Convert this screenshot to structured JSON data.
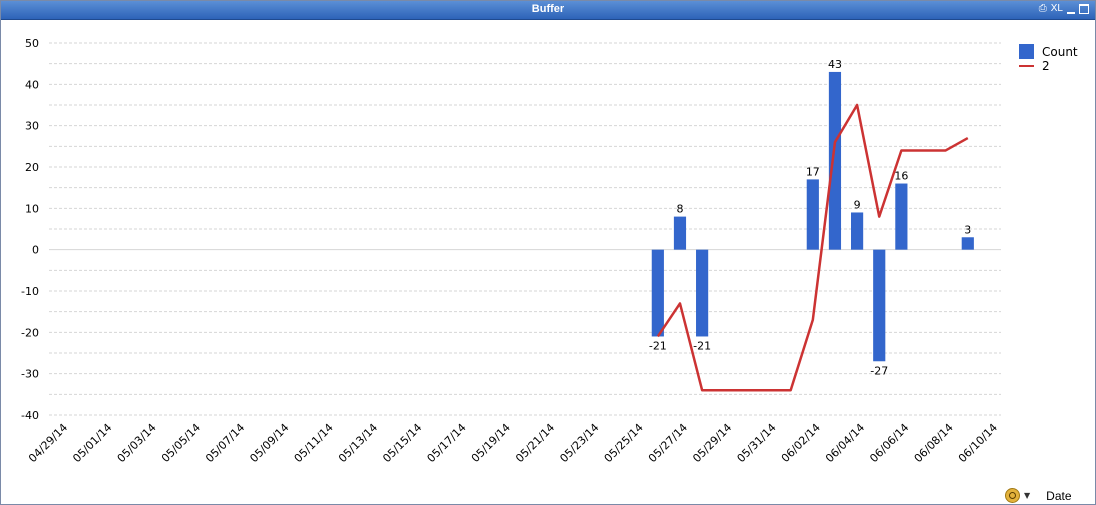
{
  "window": {
    "title": "Buffer",
    "icons": [
      "print-icon",
      "excel-icon",
      "minimize-icon",
      "maximize-icon"
    ],
    "xl_label": "XL"
  },
  "dimension_control": {
    "label": "Date",
    "icon": "cycle-icon"
  },
  "colors": {
    "bar": "#3366cc",
    "line": "#cc3333",
    "grid": "#d6d6d6",
    "title_bar": "#2d63b8"
  },
  "chart_data": {
    "type": "bar",
    "title": "",
    "xlabel": "",
    "ylabel": "",
    "ylim": [
      -40,
      50
    ],
    "yticks": [
      -40,
      -30,
      -20,
      -10,
      0,
      10,
      20,
      30,
      40,
      50
    ],
    "grid": true,
    "legend_position": "top-right",
    "x_tick_labels": [
      "04/29/14",
      "05/01/14",
      "05/03/14",
      "05/05/14",
      "05/07/14",
      "05/09/14",
      "05/11/14",
      "05/13/14",
      "05/15/14",
      "05/17/14",
      "05/19/14",
      "05/21/14",
      "05/23/14",
      "05/25/14",
      "05/27/14",
      "05/29/14",
      "05/31/14",
      "06/02/14",
      "06/04/14",
      "06/06/14",
      "06/08/14",
      "06/10/14"
    ],
    "x_range": [
      "04/29/14",
      "06/10/14"
    ],
    "series": [
      {
        "name": "Count",
        "type": "bar",
        "points": [
          {
            "x": "05/26/14",
            "y": -21,
            "label": "-21"
          },
          {
            "x": "05/27/14",
            "y": 8,
            "label": "8"
          },
          {
            "x": "05/28/14",
            "y": -21,
            "label": "-21"
          },
          {
            "x": "06/02/14",
            "y": 17,
            "label": "17"
          },
          {
            "x": "06/03/14",
            "y": 43,
            "label": "43"
          },
          {
            "x": "06/04/14",
            "y": 9,
            "label": "9"
          },
          {
            "x": "06/05/14",
            "y": -27,
            "label": "-27"
          },
          {
            "x": "06/06/14",
            "y": 16,
            "label": "16"
          },
          {
            "x": "06/09/14",
            "y": 3,
            "label": "3"
          }
        ]
      },
      {
        "name": "2",
        "type": "line",
        "points": [
          {
            "x": "05/26/14",
            "y": -21
          },
          {
            "x": "05/27/14",
            "y": -13
          },
          {
            "x": "05/28/14",
            "y": -34
          },
          {
            "x": "05/29/14",
            "y": -34
          },
          {
            "x": "05/30/14",
            "y": -34
          },
          {
            "x": "05/31/14",
            "y": -34
          },
          {
            "x": "06/01/14",
            "y": -34
          },
          {
            "x": "06/02/14",
            "y": -17
          },
          {
            "x": "06/03/14",
            "y": 26
          },
          {
            "x": "06/04/14",
            "y": 35
          },
          {
            "x": "06/05/14",
            "y": 8
          },
          {
            "x": "06/06/14",
            "y": 24
          },
          {
            "x": "06/07/14",
            "y": 24
          },
          {
            "x": "06/08/14",
            "y": 24
          },
          {
            "x": "06/09/14",
            "y": 27
          }
        ]
      }
    ]
  }
}
